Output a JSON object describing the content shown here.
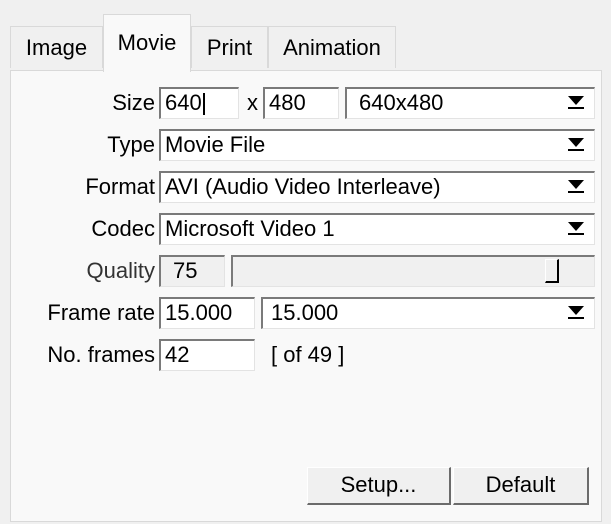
{
  "tabs": [
    {
      "label": "Image",
      "active": false
    },
    {
      "label": "Movie",
      "active": true
    },
    {
      "label": "Print",
      "active": false
    },
    {
      "label": "Animation",
      "active": false
    }
  ],
  "size": {
    "label": "Size",
    "width": "640",
    "separator": "x",
    "height": "480",
    "preset": "640x480"
  },
  "type": {
    "label": "Type",
    "value": "Movie File"
  },
  "format": {
    "label": "Format",
    "value": "AVI (Audio Video Interleave)"
  },
  "codec": {
    "label": "Codec",
    "value": "Microsoft Video 1"
  },
  "quality": {
    "label": "Quality",
    "value": "75",
    "slider_fraction": 0.9
  },
  "frame_rate": {
    "label": "Frame rate",
    "value": "15.000",
    "preset": "15.000"
  },
  "frames": {
    "label": "No. frames",
    "value": "42",
    "of_text": "[ of 49 ]"
  },
  "buttons": {
    "setup": "Setup...",
    "default": "Default"
  },
  "icons": {
    "dropdown": "dropdown-arrow-icon"
  },
  "colors": {
    "background": "#f0f0f0",
    "panel": "#f9f9f9",
    "field": "#ffffff"
  }
}
